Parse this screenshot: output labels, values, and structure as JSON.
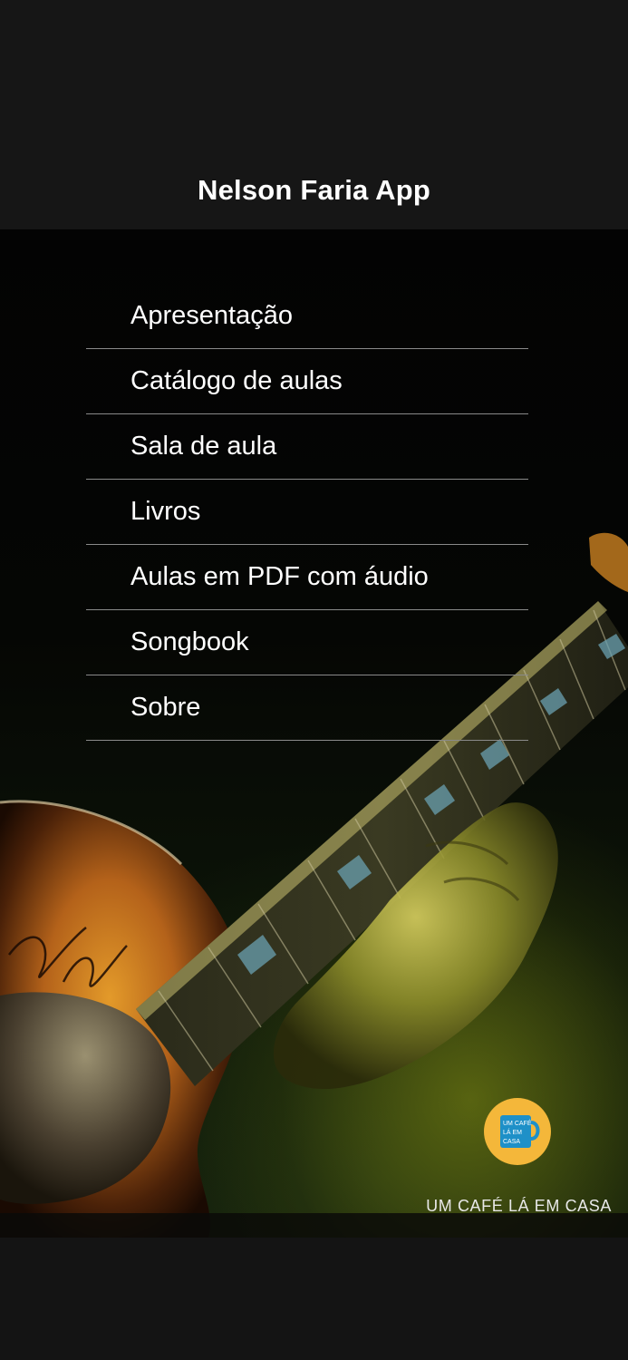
{
  "header": {
    "title": "Nelson Faria App"
  },
  "menu": {
    "items": [
      {
        "label": "Apresentação"
      },
      {
        "label": "Catálogo de aulas"
      },
      {
        "label": "Sala de aula"
      },
      {
        "label": "Livros"
      },
      {
        "label": "Aulas em PDF com áudio"
      },
      {
        "label": "Songbook"
      },
      {
        "label": "Sobre"
      }
    ]
  },
  "brand": {
    "logo_text": "UM CAFÉ LÁ EM CASA",
    "caption": "UM CAFÉ LÁ EM CASA"
  },
  "colors": {
    "background": "#141414",
    "text": "#ffffff",
    "divider": "#8a8a8a",
    "logo_yellow": "#f4b73a",
    "logo_blue": "#1e90c8"
  }
}
